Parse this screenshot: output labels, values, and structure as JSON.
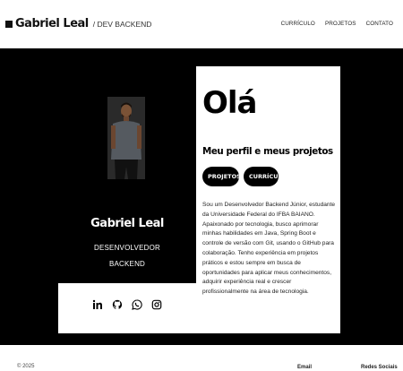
{
  "header": {
    "brand_name": "Gabriel Leal",
    "brand_role": "/ DEV BACKEND",
    "nav": [
      "CURRÍCULO",
      "PROJETOS",
      "CONTATO"
    ]
  },
  "profile": {
    "name": "Gabriel Leal",
    "role_line1": "DESENVOLVEDOR",
    "role_line2": "BACKEND"
  },
  "social_icons": [
    "linkedin-icon",
    "github-icon",
    "whatsapp-icon",
    "instagram-icon"
  ],
  "card": {
    "greeting": "Olá",
    "subtitle": "Meu perfil e meus projetos",
    "buttons": [
      "PROJETOS",
      "CURRÍCULO"
    ],
    "bio": "Sou um Desenvolvedor Backend Júnior, estudante da Universidade Federal do IFBA BAIANO. Apaixonado por tecnologia, busco aprimorar minhas habilidades em Java, Spring Boot e controle de versão com Git, usando o GitHub para colaboração. Tenho experiência em projetos práticos e estou sempre em busca de oportunidades para aplicar meus conhecimentos, adquirir experiência real e crescer profissionalmente na área de tecnologia."
  },
  "footer": {
    "copyright": "© 2025",
    "email_label": "Email",
    "social_label": "Redes Sociais"
  },
  "colors": {
    "hero_background": "#000000",
    "card_background": "#ffffff",
    "button_background": "#000000"
  }
}
